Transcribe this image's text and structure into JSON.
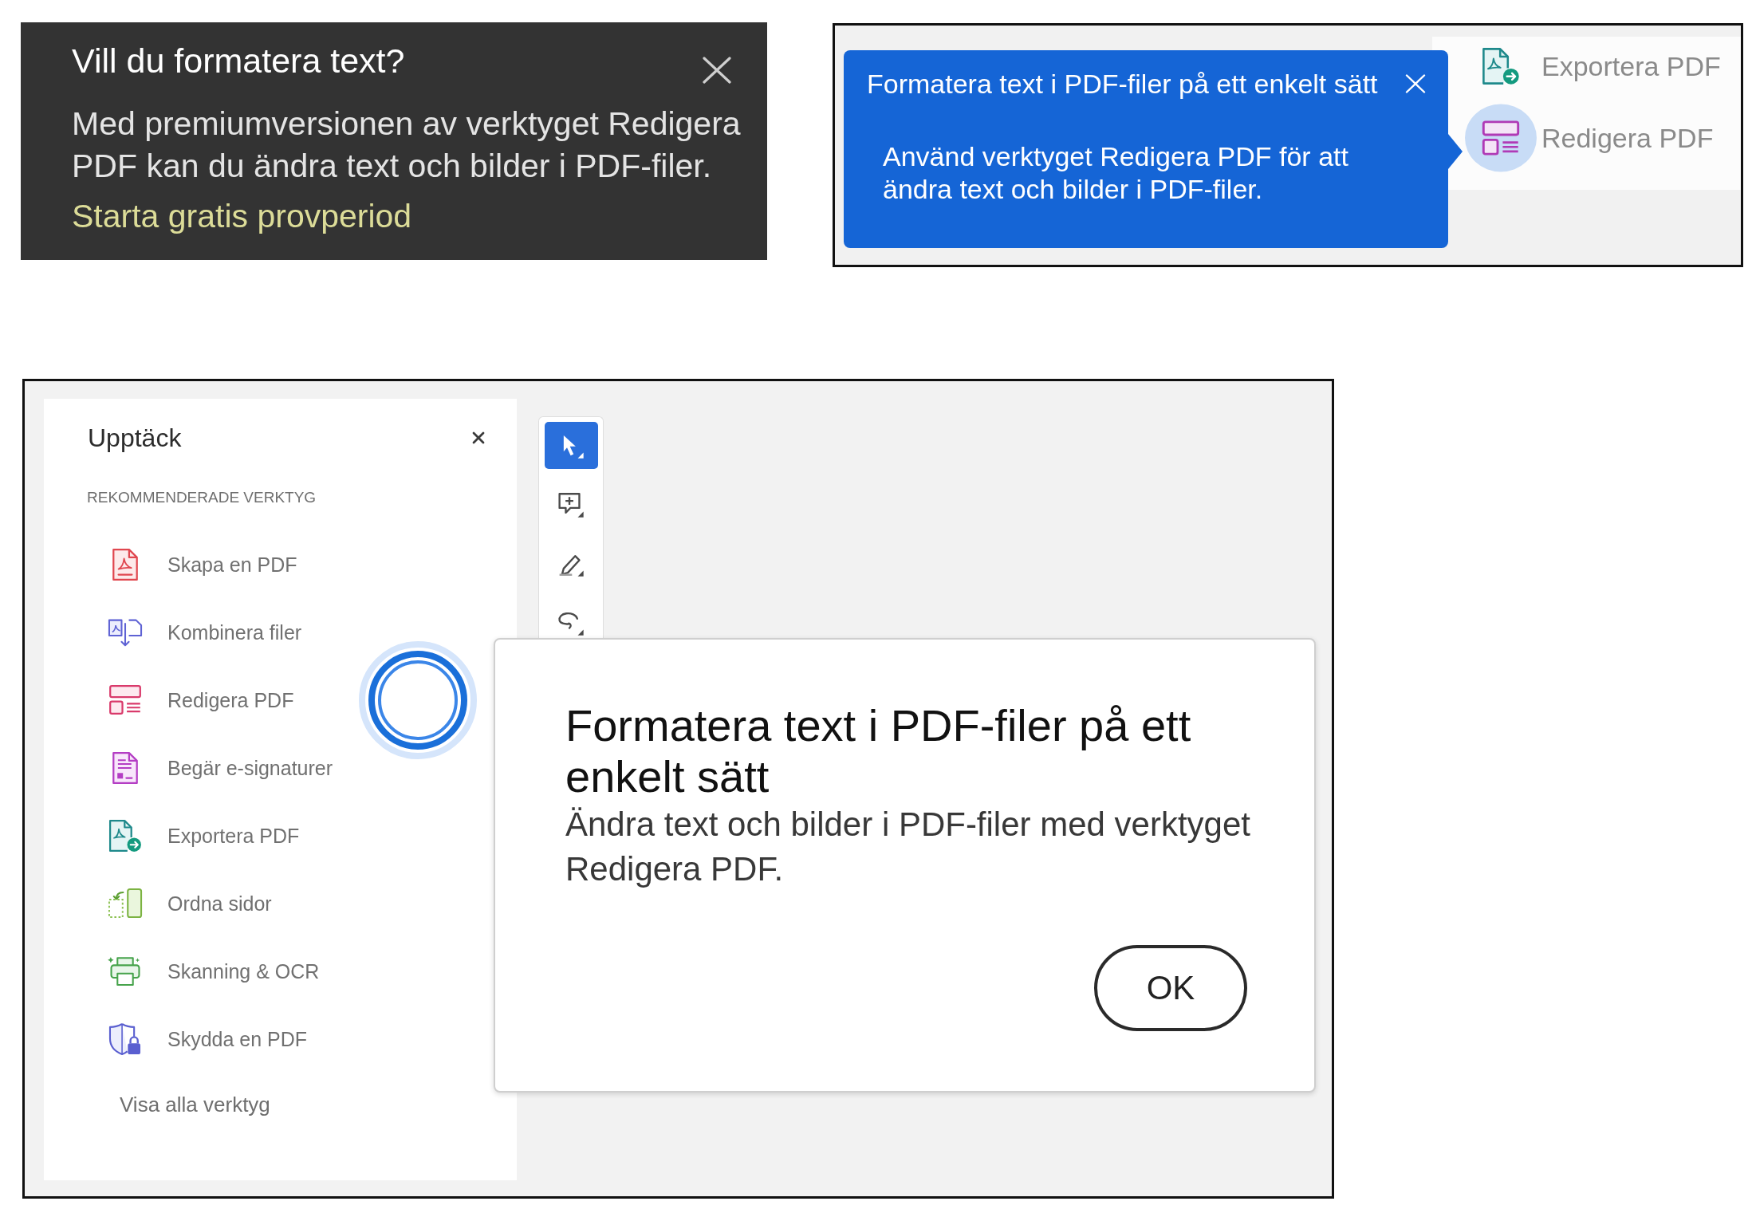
{
  "premium_tooltip": {
    "title": "Vill du formatera text?",
    "body": "Med premiumversionen av verktyget Redigera PDF kan du ändra text och bilder i PDF-filer.",
    "link": "Starta gratis provperiod"
  },
  "coach_mark": {
    "title": "Formatera text i PDF-filer på ett enkelt sätt",
    "body": "Använd verktyget Redigera PDF för att ändra text och bilder i PDF-filer.",
    "tools": [
      {
        "label": "Exportera PDF",
        "highlighted": false
      },
      {
        "label": "Redigera PDF",
        "highlighted": true
      }
    ]
  },
  "discover_panel": {
    "title": "Upptäck",
    "section_label": "REKOMMENDERADE VERKTYG",
    "tools": [
      {
        "label": "Skapa en PDF",
        "beacon": false
      },
      {
        "label": "Kombinera filer",
        "beacon": false
      },
      {
        "label": "Redigera PDF",
        "beacon": true
      },
      {
        "label": "Begär e-signaturer",
        "beacon": false
      },
      {
        "label": "Exportera PDF",
        "beacon": false
      },
      {
        "label": "Ordna sidor",
        "beacon": false
      },
      {
        "label": "Skanning & OCR",
        "beacon": false
      },
      {
        "label": "Skydda en PDF",
        "beacon": false
      }
    ],
    "show_all": "Visa alla verktyg"
  },
  "toolbar": {
    "tools": [
      {
        "selected": true
      },
      {
        "selected": false
      },
      {
        "selected": false
      },
      {
        "selected": false
      }
    ]
  },
  "dialog": {
    "title": "Formatera text i PDF-filer på ett enkelt sätt",
    "body": "Ändra text och bilder i PDF-filer med verktyget Redigera PDF.",
    "button": "OK"
  }
}
